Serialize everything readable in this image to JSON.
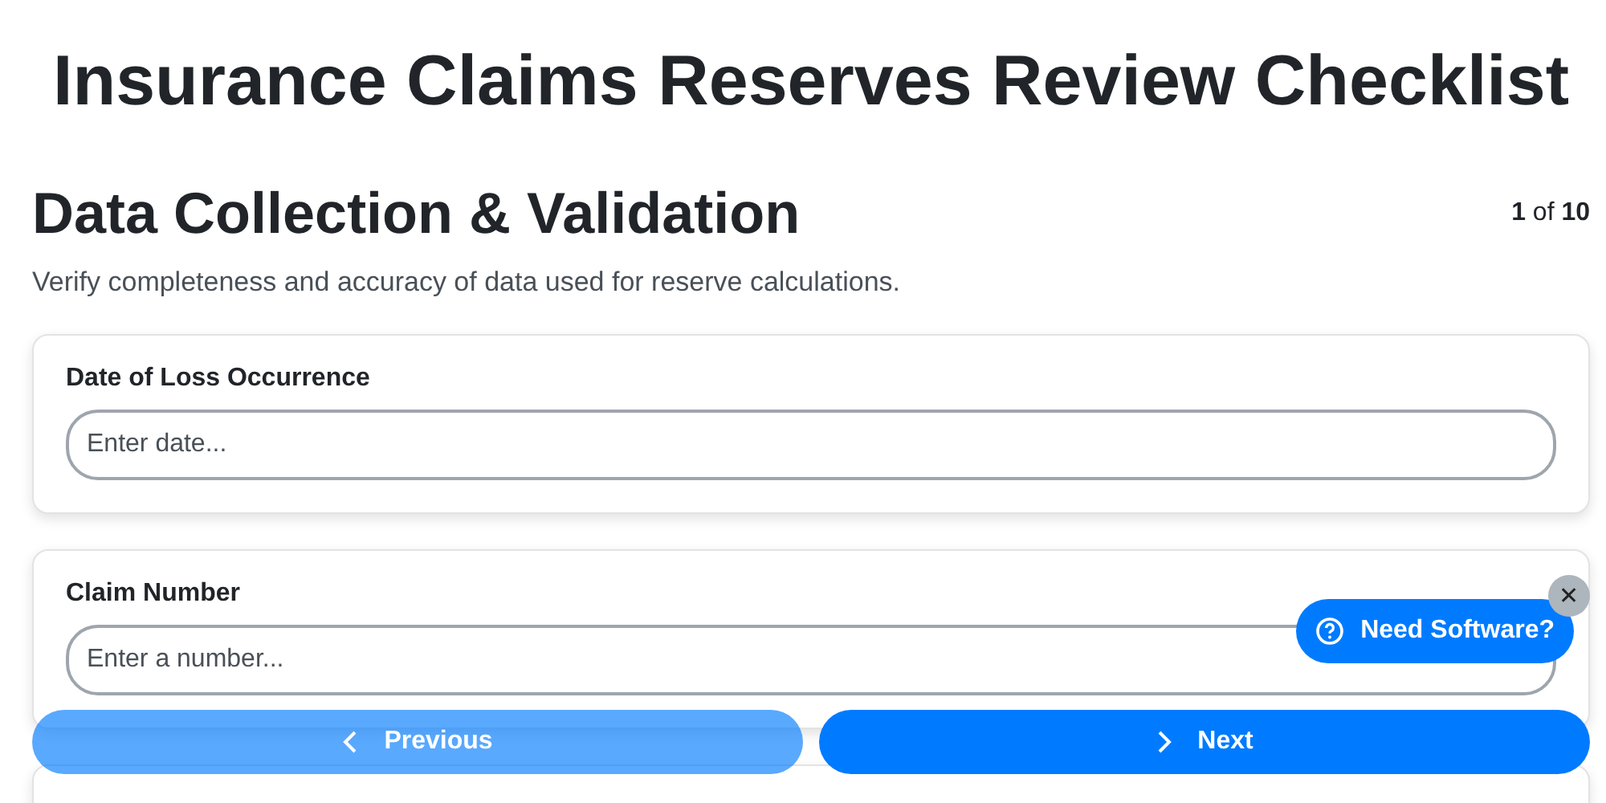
{
  "title": "Insurance Claims Reserves Review Checklist",
  "section": {
    "heading": "Data Collection & Validation",
    "pager": "**1** of **10**",
    "description": "Verify completeness and accuracy of data used for reserve calculations."
  },
  "fields": [
    {
      "label": "Date of Loss Occurrence",
      "placeholder": "Enter date..."
    },
    {
      "label": "Claim Number",
      "placeholder": "Enter a number..."
    }
  ],
  "nav": [
    {
      "kind": "previous",
      "label": "Previous",
      "disabled": true
    },
    {
      "kind": "next",
      "label": "Next",
      "disabled": false
    }
  ],
  "help": {
    "label": "Need Software?",
    "close": "✕"
  }
}
